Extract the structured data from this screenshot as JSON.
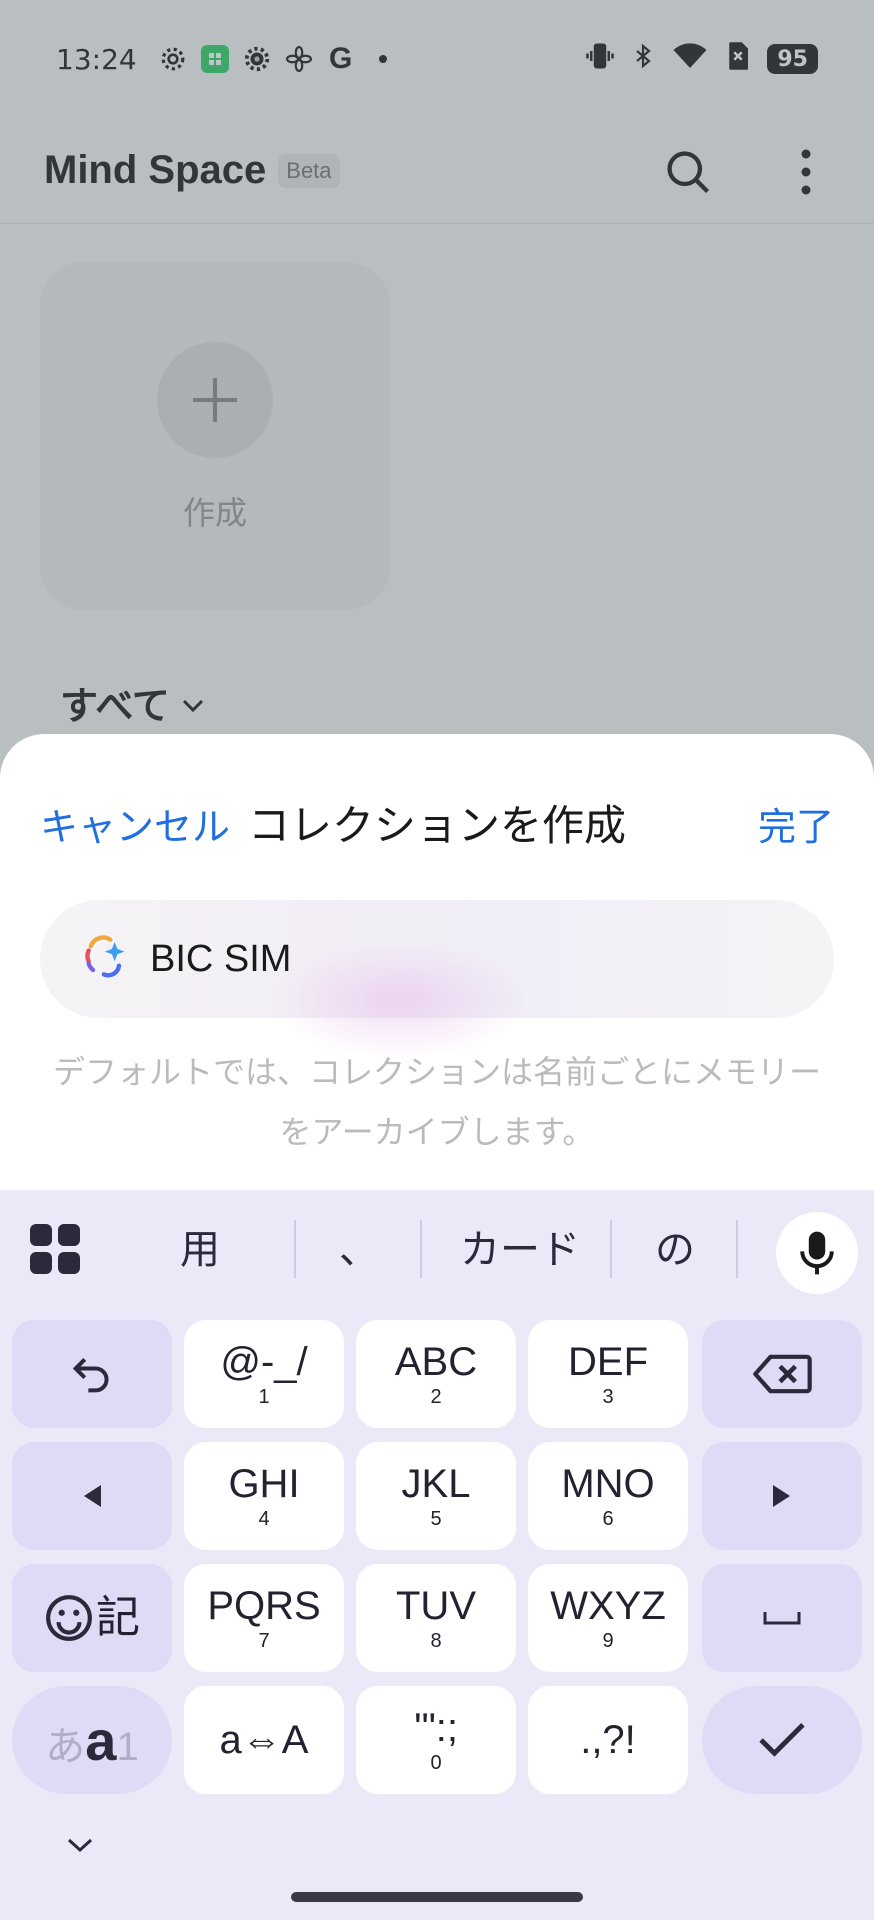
{
  "status_bar": {
    "time": "13:24",
    "left_icons": [
      "gear-icon",
      "app-grid-icon",
      "gear-icon",
      "fan-icon",
      "google-icon",
      "dot-icon"
    ],
    "google_letter": "G",
    "right_icons": [
      "vibrate-icon",
      "bluetooth-icon",
      "wifi-icon",
      "no-sim-icon"
    ],
    "battery": "95"
  },
  "app": {
    "title": "Mind Space",
    "badge": "Beta",
    "create_label": "作成",
    "filter_label": "すべて"
  },
  "sheet": {
    "cancel": "キャンセル",
    "title": "コレクションを作成",
    "done": "完了",
    "name_value": "BIC SIM",
    "hint": "デフォルトでは、コレクションは名前ごとにメモリーをアーカイブします。",
    "accent_color": "#1f6fe0"
  },
  "keyboard": {
    "suggestions": [
      "用",
      "、",
      "カード",
      "の"
    ],
    "rows": [
      [
        {
          "kind": "undo"
        },
        {
          "main": "@-_/",
          "sub": "1"
        },
        {
          "main": "ABC",
          "sub": "2"
        },
        {
          "main": "DEF",
          "sub": "3"
        },
        {
          "kind": "backspace"
        }
      ],
      [
        {
          "kind": "left"
        },
        {
          "main": "GHI",
          "sub": "4"
        },
        {
          "main": "JKL",
          "sub": "5"
        },
        {
          "main": "MNO",
          "sub": "6"
        },
        {
          "kind": "right"
        }
      ],
      [
        {
          "kind": "emoji",
          "main": "記"
        },
        {
          "main": "PQRS",
          "sub": "7"
        },
        {
          "main": "TUV",
          "sub": "8"
        },
        {
          "main": "WXYZ",
          "sub": "9"
        },
        {
          "kind": "space"
        }
      ],
      [
        {
          "kind": "mode",
          "a1": "あ",
          "a2": "a",
          "a3": "1"
        },
        {
          "main": "a⇔A"
        },
        {
          "main": "'\":;",
          "sub": "0"
        },
        {
          "main": ".,?!"
        },
        {
          "kind": "enter"
        }
      ]
    ]
  }
}
